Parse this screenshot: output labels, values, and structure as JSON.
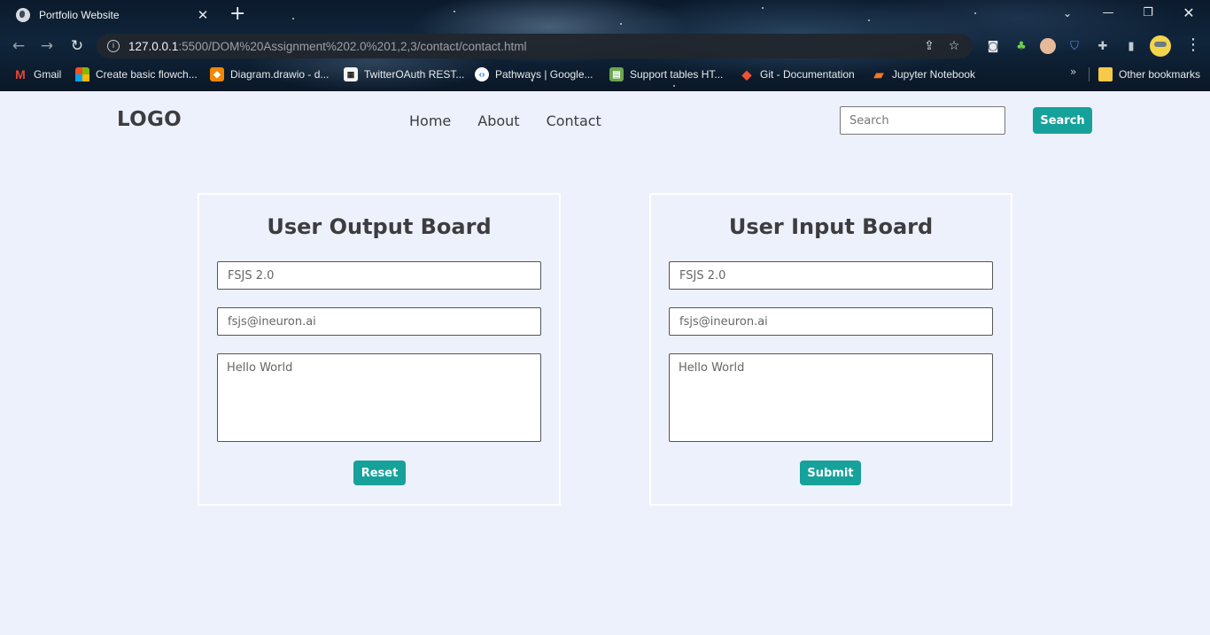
{
  "browser": {
    "tab_title": "Portfolio Website",
    "url_host": "127.0.0.1",
    "url_rest": ":5500/DOM%20Assignment%202.0%201,2,3/contact/contact.html",
    "bookmarks": [
      {
        "label": "Gmail",
        "icon": "gmail-icon"
      },
      {
        "label": "Create basic flowch...",
        "icon": "microsoft-icon"
      },
      {
        "label": "Diagram.drawio - d...",
        "icon": "drawio-icon"
      },
      {
        "label": "TwitterOAuth REST...",
        "icon": "qr-icon"
      },
      {
        "label": "Pathways  |  Google...",
        "icon": "pathways-icon"
      },
      {
        "label": "Support tables HT...",
        "icon": "support-icon"
      },
      {
        "label": "Git - Documentation",
        "icon": "git-icon"
      },
      {
        "label": "Jupyter Notebook",
        "icon": "jupyter-icon"
      }
    ],
    "other_bookmarks": "Other bookmarks"
  },
  "header": {
    "logo": "LOGO",
    "nav": [
      "Home",
      "About",
      "Contact"
    ],
    "search_placeholder": "Search",
    "search_button": "Search"
  },
  "output_board": {
    "title": "User Output Board",
    "name_placeholder": "FSJS 2.0",
    "email_placeholder": "fsjs@ineuron.ai",
    "message_placeholder": "Hello World",
    "button": "Reset"
  },
  "input_board": {
    "title": "User Input Board",
    "name_placeholder": "FSJS 2.0",
    "email_placeholder": "fsjs@ineuron.ai",
    "message_placeholder": "Hello World",
    "button": "Submit"
  },
  "colors": {
    "accent": "#16a19b",
    "page_background": "#edf1fc",
    "text": "#3d3d40"
  }
}
